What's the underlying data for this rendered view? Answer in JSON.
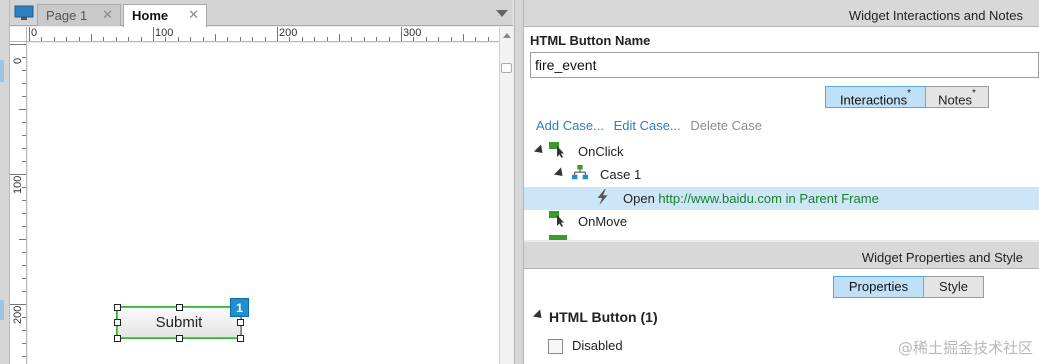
{
  "editor": {
    "tabs": [
      {
        "label": "Page 1",
        "active": false
      },
      {
        "label": "Home",
        "active": true
      }
    ],
    "close_glyph": "✕",
    "ruler_h_labels": [
      "0",
      "100",
      "200",
      "300"
    ],
    "ruler_v_labels": [
      "0",
      "100",
      "200"
    ],
    "widget": {
      "label": "Submit",
      "badge": "1"
    }
  },
  "interactions_panel": {
    "title": "Widget Interactions and Notes",
    "name_label": "HTML Button Name",
    "name_value": "fire_event",
    "tabs": [
      {
        "label": "Interactions",
        "mark": "*",
        "active": true
      },
      {
        "label": "Notes",
        "mark": "*",
        "active": false
      }
    ],
    "actions": {
      "add": "Add Case...",
      "edit": "Edit Case...",
      "delete": "Delete Case"
    },
    "tree": {
      "event1": "OnClick",
      "case1": "Case 1",
      "action_prefix": "Open ",
      "action_url": "http://www.baidu.com",
      "action_suffix": " in Parent Frame",
      "event2": "OnMove"
    }
  },
  "properties_panel": {
    "title": "Widget Properties and Style",
    "tabs": [
      {
        "label": "Properties",
        "active": true
      },
      {
        "label": "Style",
        "active": false
      }
    ],
    "section": "HTML Button (1)",
    "disabled_label": "Disabled"
  },
  "watermark": "@稀土掘金技术社区",
  "colors": {
    "accent": "#1f8fd0",
    "selection": "#cce6f7",
    "url": "#18812a",
    "event_icon": "#3a9a2a"
  }
}
